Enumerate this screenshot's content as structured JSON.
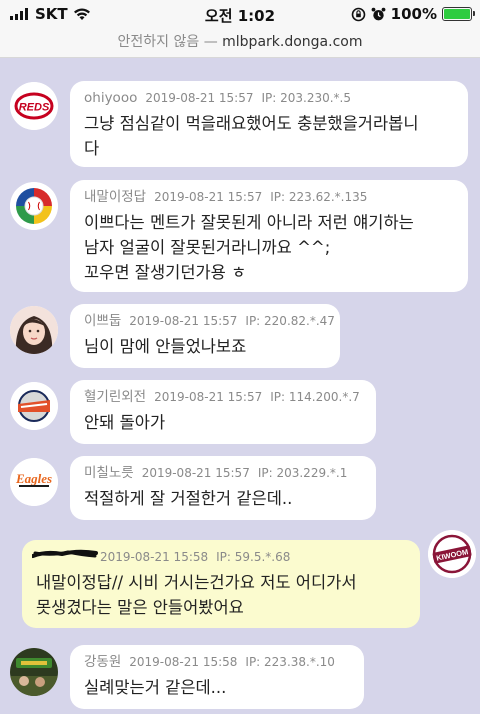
{
  "status_bar": {
    "carrier": "SKT",
    "time": "오전 1:02",
    "battery_pct": "100%",
    "battery_color": "#2ecc40",
    "icons": [
      "signal-bars-icon",
      "wifi-icon",
      "orientation-lock-icon",
      "alarm-icon",
      "battery-icon"
    ]
  },
  "url_bar": {
    "insecure_label": "안전하지 않음",
    "separator": "—",
    "host": "mlbpark.donga.com"
  },
  "comments": [
    {
      "nick": "ohiyooo",
      "date": "2019-08-21 15:57",
      "ip": "IP: 203.230.*.5",
      "lines": [
        "그냥 점심같이 먹을래요했어도 충분했을거라봅니",
        "다"
      ],
      "avatar": "reds-logo"
    },
    {
      "nick": "내말이정답",
      "date": "2019-08-21 15:57",
      "ip": "IP: 223.62.*.135",
      "lines": [
        "이쁘다는 멘트가 잘못된게 아니라 저런 얘기하는",
        "남자 얼굴이 잘못된거라니까요 ^^;",
        "꼬우면 잘생기던가용 ㅎ"
      ],
      "avatar": "baseball-logo"
    },
    {
      "nick": "이쁘둡",
      "date": "2019-08-21 15:57",
      "ip": "IP: 220.82.*.47",
      "lines": [
        "님이 맘에 안들었나보죠"
      ],
      "avatar": "profile-photo"
    },
    {
      "nick": "혈기린외전",
      "date": "2019-08-21 15:57",
      "ip": "IP: 114.200.*.7",
      "lines": [
        "안돼 돌아가"
      ],
      "avatar": "giants-logo"
    },
    {
      "nick": "미칠노릇",
      "date": "2019-08-21 15:57",
      "ip": "IP: 203.229.*.1",
      "lines": [
        "적절하게 잘 거절한거 같은데.."
      ],
      "avatar": "eagles-logo"
    },
    {
      "nick": "",
      "date": "2019-08-21 15:58",
      "ip": "IP: 59.5.*.68",
      "lines": [
        "내말이정답// 시비 거시는건가요 저도 어디가서",
        "못생겼다는 말은 안들어봤어요"
      ],
      "avatar": "kiwoom-logo"
    },
    {
      "nick": "강동원",
      "date": "2019-08-21 15:58",
      "ip": "IP: 223.38.*.10",
      "lines": [
        "실례맞는거 같은데..."
      ],
      "avatar": "photo-thumbnail"
    }
  ],
  "logo_text": {
    "reds": "REDS",
    "eagles": "Eagles",
    "kiwoom": "KIWOOM"
  },
  "colors": {
    "background": "#d6d5ea",
    "bubble": "#ffffff",
    "own_bubble": "#fbfbcf",
    "meta_text": "#8a8a8a"
  }
}
